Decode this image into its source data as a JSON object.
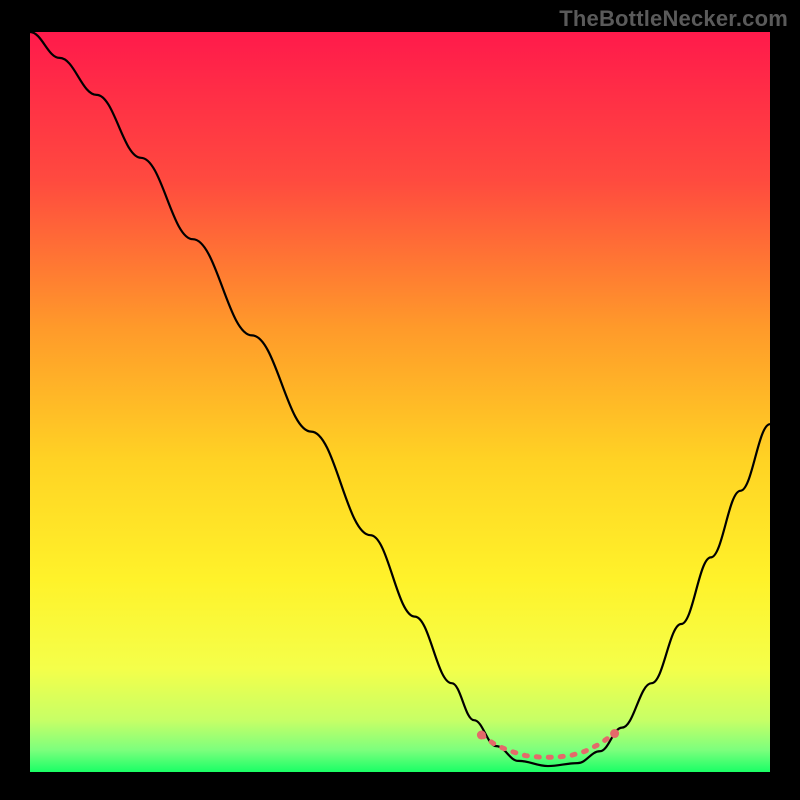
{
  "watermark": "TheBottleNecker.com",
  "chart_data": {
    "type": "line",
    "title": "",
    "xlabel": "",
    "ylabel": "",
    "xlim": [
      0,
      100
    ],
    "ylim": [
      0,
      100
    ],
    "grid": false,
    "background_gradient": {
      "stops": [
        {
          "offset": 0,
          "color": "#ff1a4b"
        },
        {
          "offset": 20,
          "color": "#ff4a3f"
        },
        {
          "offset": 40,
          "color": "#ff9a2a"
        },
        {
          "offset": 58,
          "color": "#ffd324"
        },
        {
          "offset": 74,
          "color": "#fff22a"
        },
        {
          "offset": 86,
          "color": "#f4ff4a"
        },
        {
          "offset": 93,
          "color": "#c7ff66"
        },
        {
          "offset": 97,
          "color": "#7dff7d"
        },
        {
          "offset": 100,
          "color": "#1aff66"
        }
      ]
    },
    "series": [
      {
        "name": "bottleneck-curve",
        "color": "#000000",
        "points": [
          {
            "x": 0,
            "y": 100
          },
          {
            "x": 4,
            "y": 96.5
          },
          {
            "x": 9,
            "y": 91.5
          },
          {
            "x": 15,
            "y": 83
          },
          {
            "x": 22,
            "y": 72
          },
          {
            "x": 30,
            "y": 59
          },
          {
            "x": 38,
            "y": 46
          },
          {
            "x": 46,
            "y": 32
          },
          {
            "x": 52,
            "y": 21
          },
          {
            "x": 57,
            "y": 12
          },
          {
            "x": 60,
            "y": 7
          },
          {
            "x": 63,
            "y": 3.5
          },
          {
            "x": 66,
            "y": 1.5
          },
          {
            "x": 70,
            "y": 0.8
          },
          {
            "x": 74,
            "y": 1.2
          },
          {
            "x": 77,
            "y": 2.8
          },
          {
            "x": 80,
            "y": 6
          },
          {
            "x": 84,
            "y": 12
          },
          {
            "x": 88,
            "y": 20
          },
          {
            "x": 92,
            "y": 29
          },
          {
            "x": 96,
            "y": 38
          },
          {
            "x": 100,
            "y": 47
          }
        ]
      },
      {
        "name": "optimal-zone-marker",
        "color": "#e46a6a",
        "style": "dashed-dots",
        "points": [
          {
            "x": 61,
            "y": 5.0
          },
          {
            "x": 63,
            "y": 3.6
          },
          {
            "x": 65,
            "y": 2.8
          },
          {
            "x": 67,
            "y": 2.2
          },
          {
            "x": 69,
            "y": 2.0
          },
          {
            "x": 71,
            "y": 2.0
          },
          {
            "x": 73,
            "y": 2.2
          },
          {
            "x": 75,
            "y": 2.8
          },
          {
            "x": 77,
            "y": 3.8
          },
          {
            "x": 79,
            "y": 5.2
          }
        ]
      }
    ]
  }
}
